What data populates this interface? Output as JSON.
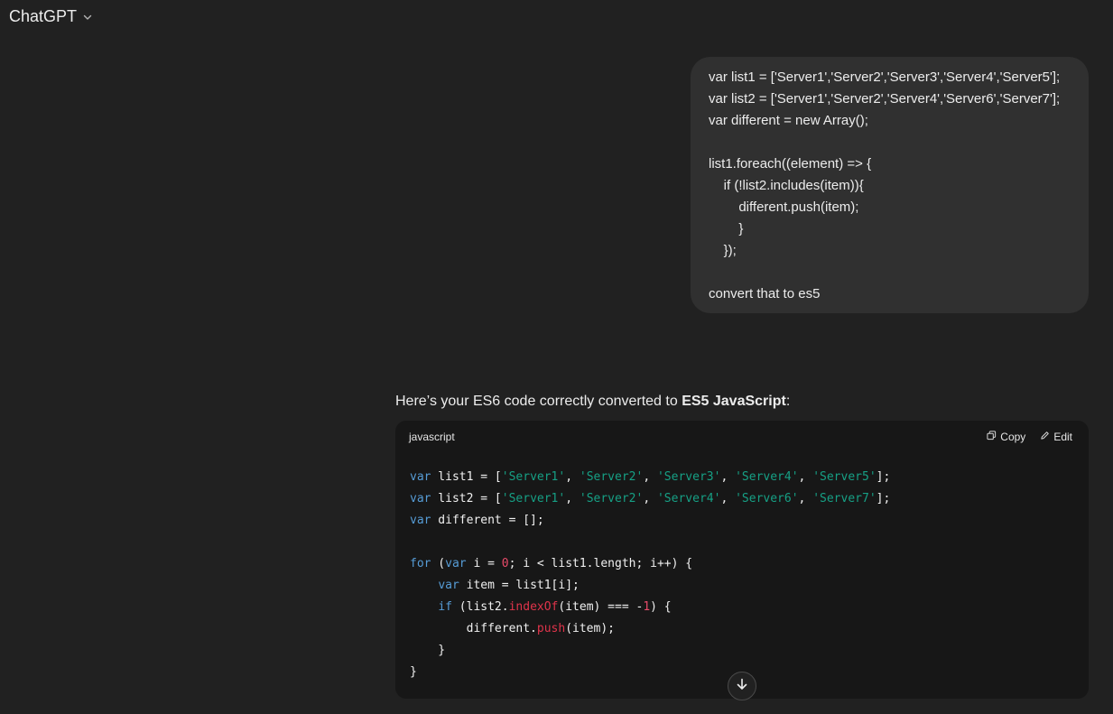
{
  "header": {
    "title": "ChatGPT",
    "model_menu_icon": "chevron-down-icon"
  },
  "user_message": {
    "lines": [
      "var list1 = ['Server1','Server2','Server3','Server4','Server5'];",
      "var list2 = ['Server1','Server2','Server4','Server6','Server7'];",
      "var different = new Array();",
      "",
      "list1.foreach((element) => {",
      "    if (!list2.includes(item)){",
      "        different.push(item);",
      "        }",
      "    });",
      "",
      "convert that to es5"
    ]
  },
  "assistant": {
    "intro_prefix": "Here’s your ES6 code correctly converted to ",
    "intro_bold": "ES5 JavaScript",
    "intro_suffix": ":",
    "code": {
      "language": "javascript",
      "copy_label": "Copy",
      "copy_icon": "copy-icon",
      "edit_label": "Edit",
      "edit_icon": "edit-icon",
      "lines": [
        [
          {
            "t": "var",
            "c": "kw"
          },
          {
            "t": " list1 = ["
          },
          {
            "t": "'Server1'",
            "c": "str"
          },
          {
            "t": ", "
          },
          {
            "t": "'Server2'",
            "c": "str"
          },
          {
            "t": ", "
          },
          {
            "t": "'Server3'",
            "c": "str"
          },
          {
            "t": ", "
          },
          {
            "t": "'Server4'",
            "c": "str"
          },
          {
            "t": ", "
          },
          {
            "t": "'Server5'",
            "c": "str"
          },
          {
            "t": "];"
          }
        ],
        [
          {
            "t": "var",
            "c": "kw"
          },
          {
            "t": " list2 = ["
          },
          {
            "t": "'Server1'",
            "c": "str"
          },
          {
            "t": ", "
          },
          {
            "t": "'Server2'",
            "c": "str"
          },
          {
            "t": ", "
          },
          {
            "t": "'Server4'",
            "c": "str"
          },
          {
            "t": ", "
          },
          {
            "t": "'Server6'",
            "c": "str"
          },
          {
            "t": ", "
          },
          {
            "t": "'Server7'",
            "c": "str"
          },
          {
            "t": "];"
          }
        ],
        [
          {
            "t": "var",
            "c": "kw"
          },
          {
            "t": " different = [];"
          }
        ],
        [],
        [
          {
            "t": "for",
            "c": "kw"
          },
          {
            "t": " ("
          },
          {
            "t": "var",
            "c": "kw"
          },
          {
            "t": " i = "
          },
          {
            "t": "0",
            "c": "num"
          },
          {
            "t": "; i < list1.length; i++) {"
          }
        ],
        [
          {
            "t": "    "
          },
          {
            "t": "var",
            "c": "kw"
          },
          {
            "t": " item = list1[i];"
          }
        ],
        [
          {
            "t": "    "
          },
          {
            "t": "if",
            "c": "kw"
          },
          {
            "t": " (list2."
          },
          {
            "t": "indexOf",
            "c": "fn"
          },
          {
            "t": "(item) === -"
          },
          {
            "t": "1",
            "c": "num"
          },
          {
            "t": ") {"
          }
        ],
        [
          {
            "t": "        different."
          },
          {
            "t": "push",
            "c": "fn"
          },
          {
            "t": "(item);"
          }
        ],
        [
          {
            "t": "    }"
          }
        ],
        [
          {
            "t": "}"
          }
        ]
      ]
    }
  },
  "scroll_button": {
    "icon": "arrow-down-icon"
  }
}
